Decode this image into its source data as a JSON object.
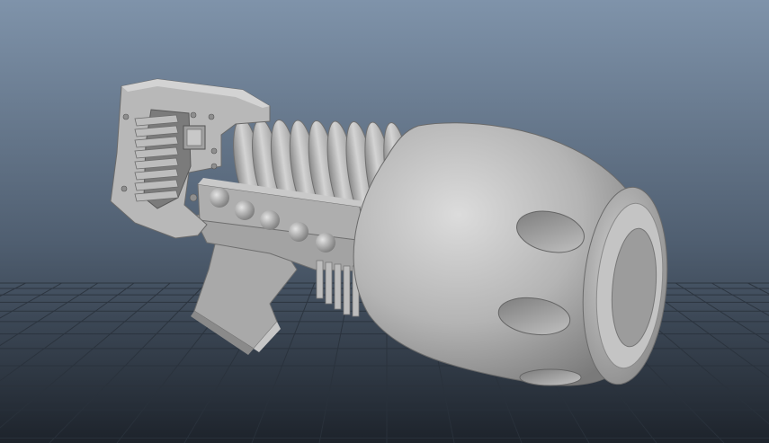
{
  "viewport": {
    "background_top": "#7f93aa",
    "background_bottom": "#1d232b",
    "grid_color": "#2a323c"
  },
  "model": {
    "surface_color": "#b4b4b4",
    "shadow_color": "#6a6a6a",
    "highlight_color": "#d8d8d8"
  }
}
